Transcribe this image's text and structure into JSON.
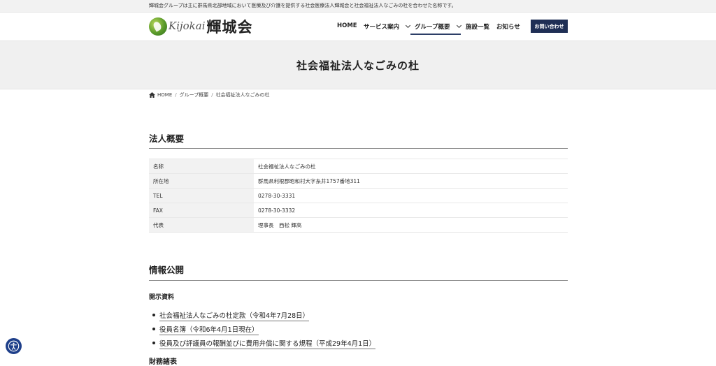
{
  "topbar": {
    "text": "輝城会グループは主に群馬県北部地域において医療及び介護を提供する社会医療法人輝城会と社会福祉法人なごみの杜を合わせた名称です。"
  },
  "logo": {
    "script": "Kijokai",
    "kanji": "輝城会"
  },
  "nav": {
    "items": [
      "HOME",
      "サービス案内",
      "グループ概要",
      "施設一覧",
      "お知らせ"
    ],
    "active": "グループ概要",
    "contact": "お問い合わせ"
  },
  "banner": {
    "title": "社会福祉法人なごみの杜"
  },
  "breadcrumb": [
    "HOME",
    "グループ概要",
    "社会福祉法人なごみの杜"
  ],
  "overview": {
    "title": "法人概要",
    "rows": [
      {
        "key": "名称",
        "value": "社会福祉法人なごみの杜"
      },
      {
        "key": "所在地",
        "value": "群馬県利根郡昭和村大字糸井1757番地311"
      },
      {
        "key": "TEL",
        "value": "0278-30-3331"
      },
      {
        "key": "FAX",
        "value": "0278-30-3332"
      },
      {
        "key": "代表",
        "value": "理事長　西松 輝高"
      }
    ]
  },
  "disclosure": {
    "title": "情報公開",
    "subtitle": "開示資料",
    "documents": [
      "社会福祉法人なごみの杜定款（令和4年7月28日）",
      "役員名簿（令和6年4月1日現在）",
      "役員及び評議員の報酬並びに費用弁償に関する規程（平成29年4月1日）"
    ],
    "next_title": "財務諸表"
  },
  "colors": {
    "accent": "#1f2f55",
    "banner_bg": "#f0f0f0",
    "a11y": "#1e3f8a"
  },
  "icons": {
    "home": "home-icon",
    "accessibility": "accessibility-icon",
    "chevron": "chevron-down-icon"
  }
}
